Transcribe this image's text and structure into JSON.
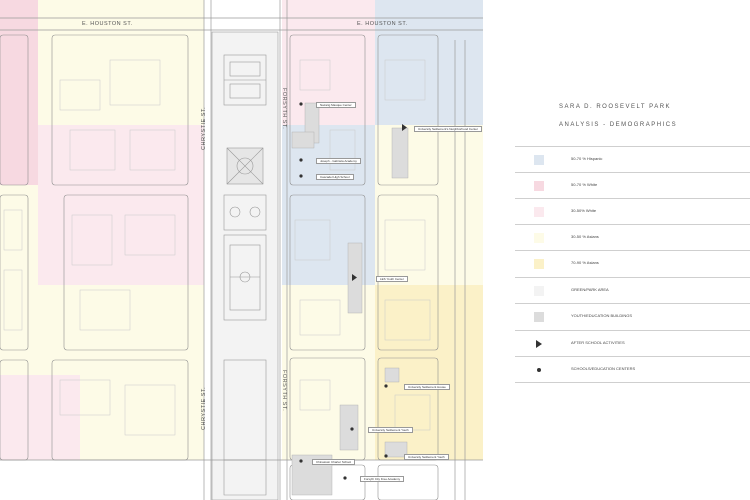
{
  "streets": {
    "houston_left": "E. HOUSTON ST.",
    "houston_right": "E. HOUSTON ST.",
    "chrystie_upper": "CHRYSTIE ST.",
    "chrystie_lower": "CHRYSTIE ST.",
    "forsyth_upper": "FORSYTH ST.",
    "forsyth_lower": "FORSYTH ST."
  },
  "places": [
    {
      "name": "Nazarig Masque Center"
    },
    {
      "name": "University Settlement's Neighborhood Center"
    },
    {
      "name": "Joseph - Gabriela Academy"
    },
    {
      "name": "Cascadel High School"
    },
    {
      "name": "LES Youth Center"
    },
    {
      "name": "University Settlement House"
    },
    {
      "name": "University Settlement Youth"
    },
    {
      "name": "University Settlement Youth"
    },
    {
      "name": "Chinatown Charter School"
    },
    {
      "name": "Forsyth City Free Academy"
    }
  ],
  "legend": {
    "title": "SARA D. ROOSEVELT PARK",
    "subtitle": "ANALYSIS - DEMOGRAPHICS",
    "items": [
      {
        "label": "50-70 % Hispanic",
        "color": "#dde6f0",
        "marker": "swatch"
      },
      {
        "label": "50-70 % White",
        "color": "#f7d9e1",
        "marker": "swatch"
      },
      {
        "label": "30-50% White",
        "color": "#fbe9ee",
        "marker": "swatch"
      },
      {
        "label": "30-50 % Asians",
        "color": "#fdfbe7",
        "marker": "swatch"
      },
      {
        "label": "70-90 % Asians",
        "color": "#fbf1c8",
        "marker": "swatch"
      },
      {
        "label": "GREEN/PARK AREA",
        "color": "#f3f3f3",
        "marker": "swatch"
      },
      {
        "label": "YOUTH/EDUCATION BUILDINGS",
        "color": "#dcdcdc",
        "marker": "swatch"
      },
      {
        "label": "AFTER SCHOOL ACTIVITIES",
        "color": "#333333",
        "marker": "triangle"
      },
      {
        "label": "SCHOOLS/EDUCATION CENTERS",
        "color": "#333333",
        "marker": "dot"
      }
    ]
  }
}
